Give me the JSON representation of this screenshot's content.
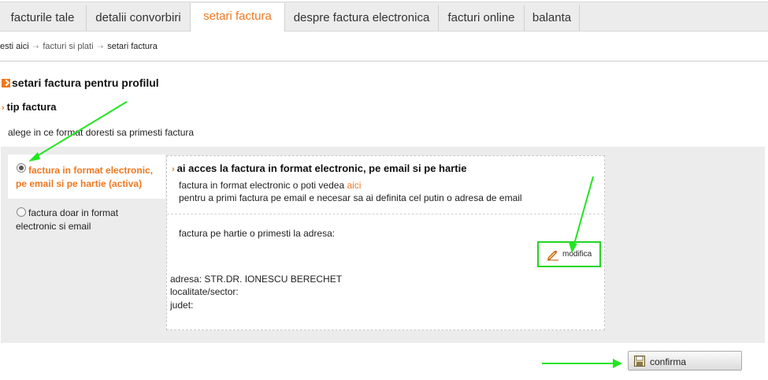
{
  "tabs": [
    {
      "label": "facturile tale"
    },
    {
      "label": "detalii convorbiri"
    },
    {
      "label": "setari factura"
    },
    {
      "label": "despre factura electronica"
    },
    {
      "label": "facturi online"
    },
    {
      "label": "balanta"
    }
  ],
  "breadcrumb": {
    "item1": "esti aici",
    "item2": "facturi si plati",
    "item3": "setari factura",
    "separator": "⇢"
  },
  "page": {
    "title": "setari factura pentru profilul",
    "subtitle": "tip factura",
    "intro": "alege in ce format doresti sa primesti factura"
  },
  "options": [
    {
      "label": "factura in format electronic, pe email si pe hartie (activa)",
      "selected": true
    },
    {
      "label": "factura doar in format electronic si email",
      "selected": false
    }
  ],
  "detail": {
    "title": "ai acces la factura in format electronic, pe email si pe hartie",
    "line1_prefix": "factura in format electronic o poti vedea",
    "line1_link": "aici",
    "line2": "pentru a primi factura pe email e necesar sa ai definita cel putin o adresa de email",
    "paper_text": "factura pe hartie o primesti la adresa:",
    "modify_label": "modifica",
    "address_line": "adresa: STR.DR. IONESCU BERECHET",
    "locality_line": "localitate/sector:",
    "county_line": "judet:"
  },
  "confirm_label": "confirma",
  "colors": {
    "accent": "#f07820",
    "highlight_green": "#22d622",
    "panel_bg": "#ececec"
  }
}
